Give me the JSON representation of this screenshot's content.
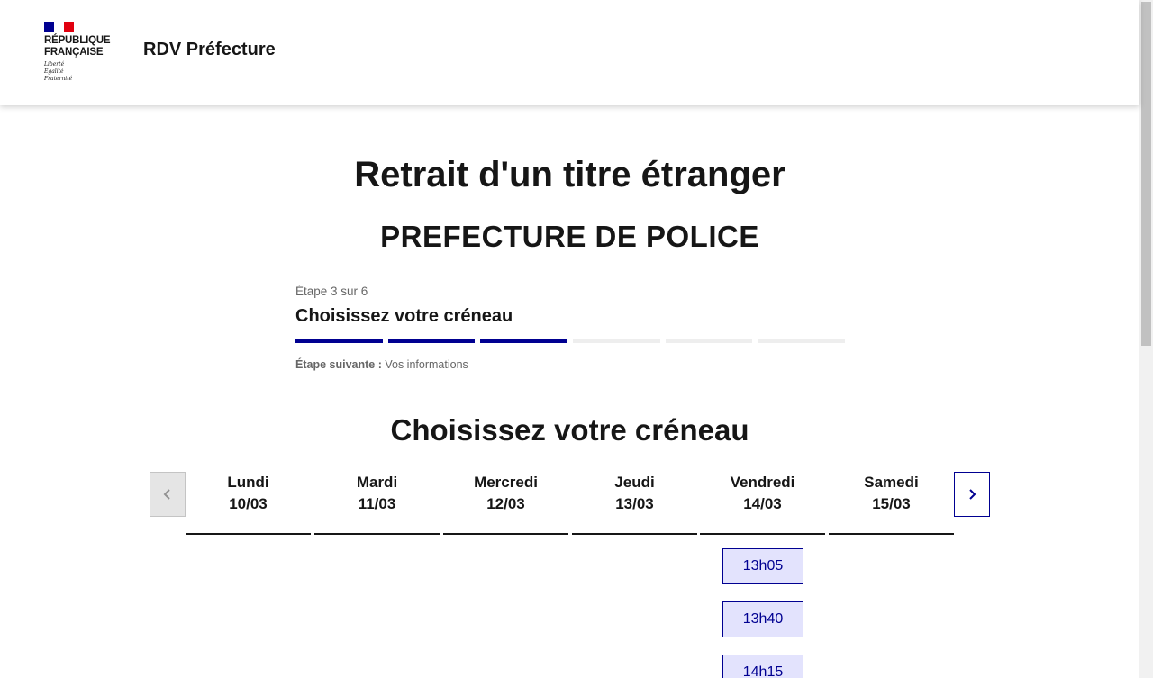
{
  "header": {
    "logo_line1": "RÉPUBLIQUE",
    "logo_line2": "FRANÇAISE",
    "devise": [
      "Liberté",
      "Égalité",
      "Fraternité"
    ],
    "service_title": "RDV Préfecture",
    "flag_colors": [
      "#000091",
      "#ffffff",
      "#e1000f"
    ]
  },
  "page": {
    "title": "Retrait d'un titre étranger",
    "subtitle": "PREFECTURE DE POLICE"
  },
  "stepper": {
    "state": "Étape 3 sur 6",
    "title": "Choisissez votre créneau",
    "current_step": 3,
    "total_steps": 6,
    "next_label": "Étape suivante :",
    "next_value": "Vos informations"
  },
  "calendar": {
    "title": "Choisissez votre créneau",
    "prev_icon": "chevron-left-icon",
    "next_icon": "chevron-right-icon",
    "days": [
      {
        "name": "Lundi",
        "date": "10/03"
      },
      {
        "name": "Mardi",
        "date": "11/03"
      },
      {
        "name": "Mercredi",
        "date": "12/03"
      },
      {
        "name": "Jeudi",
        "date": "13/03"
      },
      {
        "name": "Vendredi",
        "date": "14/03"
      },
      {
        "name": "Samedi",
        "date": "15/03"
      }
    ],
    "slots": [
      "13h05",
      "13h40",
      "14h15"
    ]
  },
  "colors": {
    "accent": "#000091",
    "slot_bg": "#e3e3fd",
    "step_inactive": "#eeeeee",
    "text": "#161616",
    "muted": "#666666"
  }
}
